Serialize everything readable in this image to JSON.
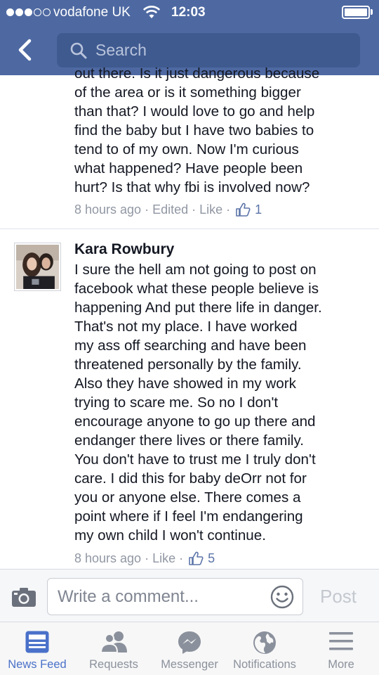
{
  "status_bar": {
    "carrier": "vodafone UK",
    "time": "12:03",
    "signal_bars_filled": 3,
    "signal_bars_total": 5
  },
  "header": {
    "search_placeholder": "Search"
  },
  "comments": [
    {
      "text_lines": [
        "out there. Is it just dangerous because",
        "of the area or is it something bigger",
        "than that? I would love to go and help",
        "find the baby but I have two babies to",
        "tend to of my own. Now I'm curious",
        "what happened? Have people been",
        "hurt? Is that why fbi is involved now?"
      ],
      "time_ago": "8 hours ago",
      "edited": "Edited",
      "like_label": "Like",
      "like_count": "1"
    },
    {
      "author": "Kara Rowbury",
      "text_lines": [
        "I sure the hell am not going to post on",
        "facebook what these people believe is",
        "happening And put there life in danger.",
        "That's not my place.  I have worked",
        "my ass off searching and have been",
        "threatened personally by the family.",
        "Also they have showed in my work",
        "trying to scare me.  So no I don't",
        "encourage anyone to go up there and",
        "endanger there lives or there family.",
        "You don't have to trust me I truly don't",
        "care.  I did this for baby deOrr not for",
        "you or anyone else. There comes a",
        "point where if I feel I'm endangering",
        "my own child I won't continue."
      ],
      "time_ago": "8 hours ago",
      "like_label": "Like",
      "like_count": "5"
    }
  ],
  "composer": {
    "placeholder": "Write a comment...",
    "post_label": "Post"
  },
  "tabbar": {
    "tabs": [
      {
        "label": "News Feed",
        "icon": "news-feed-icon",
        "active": true
      },
      {
        "label": "Requests",
        "icon": "friend-requests-icon",
        "active": false
      },
      {
        "label": "Messenger",
        "icon": "messenger-icon",
        "active": false
      },
      {
        "label": "Notifications",
        "icon": "globe-icon",
        "active": false
      },
      {
        "label": "More",
        "icon": "hamburger-menu-icon",
        "active": false
      }
    ]
  },
  "colors": {
    "header_blue": "#4e69a2",
    "search_field": "#3f5a8f",
    "active_tab": "#4a71c9",
    "meta_gray": "#9197a3"
  }
}
